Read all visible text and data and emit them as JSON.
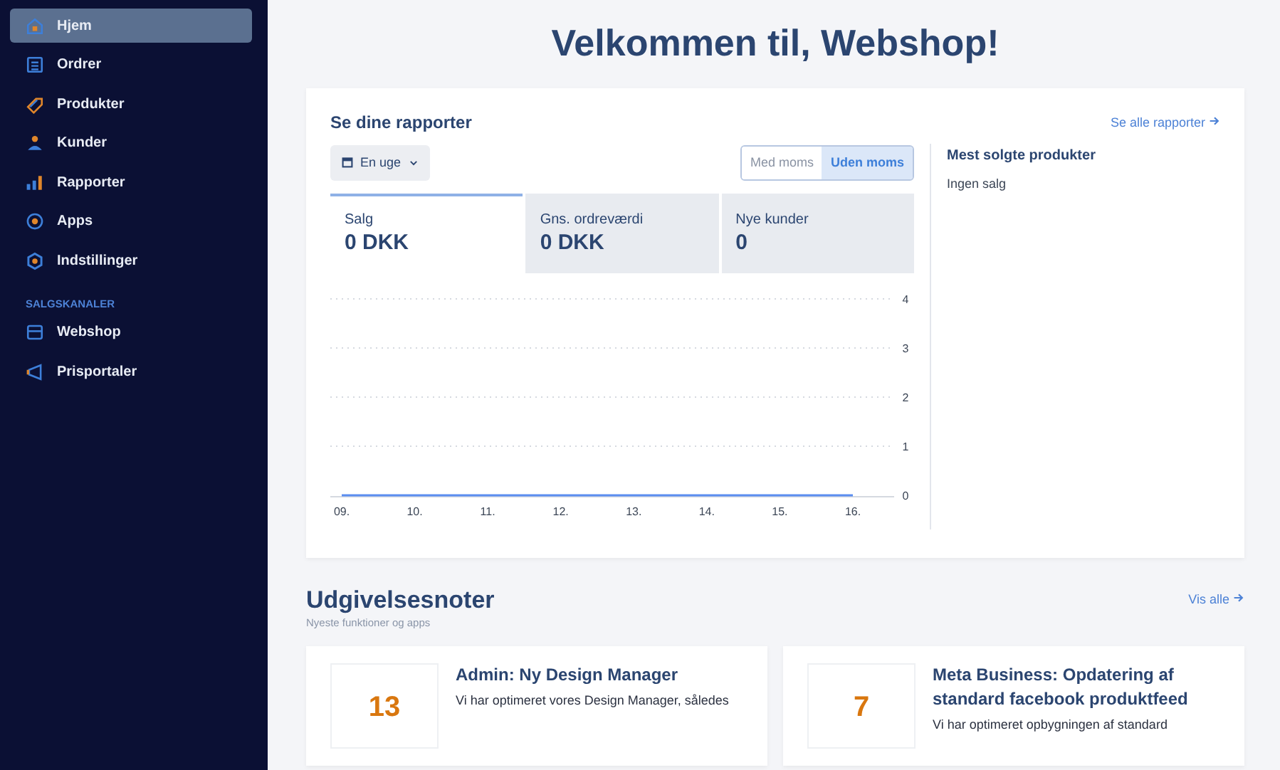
{
  "sidebar": {
    "items": [
      {
        "label": "Hjem",
        "selected": true
      },
      {
        "label": "Ordrer",
        "selected": false
      },
      {
        "label": "Produkter",
        "selected": false
      },
      {
        "label": "Kunder",
        "selected": false
      },
      {
        "label": "Rapporter",
        "selected": false
      },
      {
        "label": "Apps",
        "selected": false
      },
      {
        "label": "Indstillinger",
        "selected": false
      }
    ],
    "section_label": "SALGSKANALER",
    "channel_items": [
      {
        "label": "Webshop",
        "selected": false
      },
      {
        "label": "Prisportaler",
        "selected": false
      }
    ]
  },
  "page_title": "Velkommen til, Webshop!",
  "reports": {
    "title": "Se dine rapporter",
    "link": "Se alle rapporter",
    "period": "En uge",
    "vat_toggle": [
      {
        "label": "Med moms",
        "selected": false
      },
      {
        "label": "Uden moms",
        "selected": true
      }
    ],
    "metrics": [
      {
        "label": "Salg",
        "value": "0 DKK",
        "selected": true
      },
      {
        "label": "Gns. ordreværdi",
        "value": "0 DKK",
        "selected": false
      },
      {
        "label": "Nye kunder",
        "value": "0",
        "selected": false
      }
    ],
    "chart_data": {
      "type": "line",
      "categories": [
        "09.",
        "10.",
        "11.",
        "12.",
        "13.",
        "14.",
        "15.",
        "16."
      ],
      "series": [
        {
          "color": "#5b8def",
          "values": [
            0,
            0,
            0,
            0,
            0,
            0,
            0,
            0
          ]
        }
      ],
      "ylim": [
        0,
        4
      ],
      "yticks": [
        0,
        1,
        2,
        3,
        4
      ],
      "grid": true
    },
    "top_products": {
      "title": "Mest solgte produkter",
      "empty_text": "Ingen salg"
    }
  },
  "release_notes": {
    "title": "Udgivelsesnoter",
    "subtitle": "Nyeste funktioner og apps",
    "link": "Vis alle",
    "notes": [
      {
        "day": "13",
        "title": "Admin: Ny Design Manager",
        "body": "Vi har optimeret vores Design Manager, således"
      },
      {
        "day": "7",
        "title": "Meta Business: Opdatering af standard facebook produktfeed",
        "body": "Vi har optimeret opbygningen af standard"
      }
    ]
  }
}
